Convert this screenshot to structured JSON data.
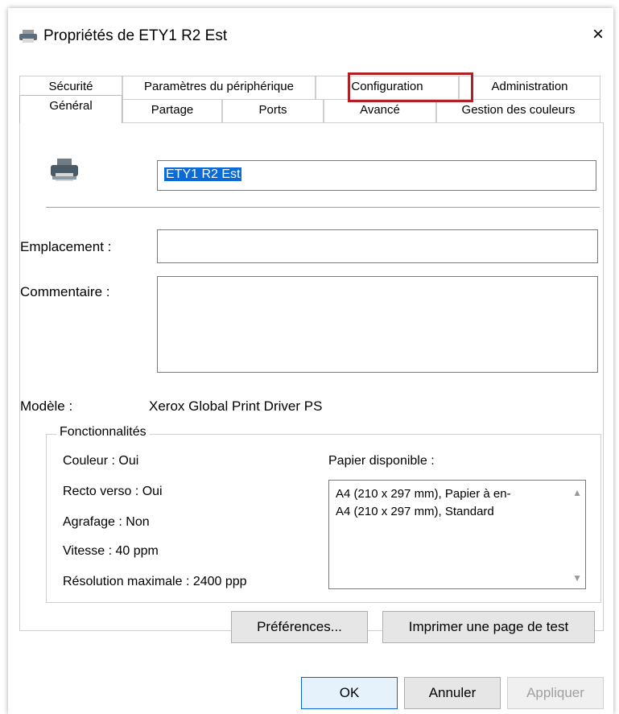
{
  "window": {
    "title": "Propriétés de ETY1 R2 Est",
    "close_icon": "×"
  },
  "tabs": {
    "row1": [
      "Sécurité",
      "Paramètres du périphérique",
      "Configuration",
      "Administration"
    ],
    "row2": [
      "Général",
      "Partage",
      "Ports",
      "Avancé",
      "Gestion des couleurs"
    ],
    "selected": "Général",
    "highlighted": "Configuration",
    "highlight_color": "#b21f24"
  },
  "general": {
    "printer_name": "ETY1 R2 Est",
    "emplacement_label": "Emplacement :",
    "emplacement_value": "",
    "commentaire_label": "Commentaire :",
    "commentaire_value": "",
    "modele_label": "Modèle :",
    "modele_value": "Xerox Global Print Driver PS"
  },
  "features": {
    "title": "Fonctionnalités",
    "couleur": "Couleur : Oui",
    "recto_verso": "Recto verso : Oui",
    "agrafage": "Agrafage : Non",
    "vitesse": "Vitesse : 40 ppm",
    "resolution": "Résolution maximale : 2400 ppp",
    "papier_label": "Papier disponible :",
    "papier_items": [
      "A4 (210 x 297 mm), Papier à en-",
      "A4 (210 x 297 mm), Standard"
    ]
  },
  "buttons": {
    "preferences": "Préférences...",
    "test_page": "Imprimer une page de test",
    "ok": "OK",
    "annuler": "Annuler",
    "appliquer": "Appliquer"
  },
  "icons": [
    "printer-icon",
    "close-icon",
    "scroll-up-icon",
    "scroll-down-icon"
  ],
  "colors": {
    "selection": "#0a6bd6"
  }
}
